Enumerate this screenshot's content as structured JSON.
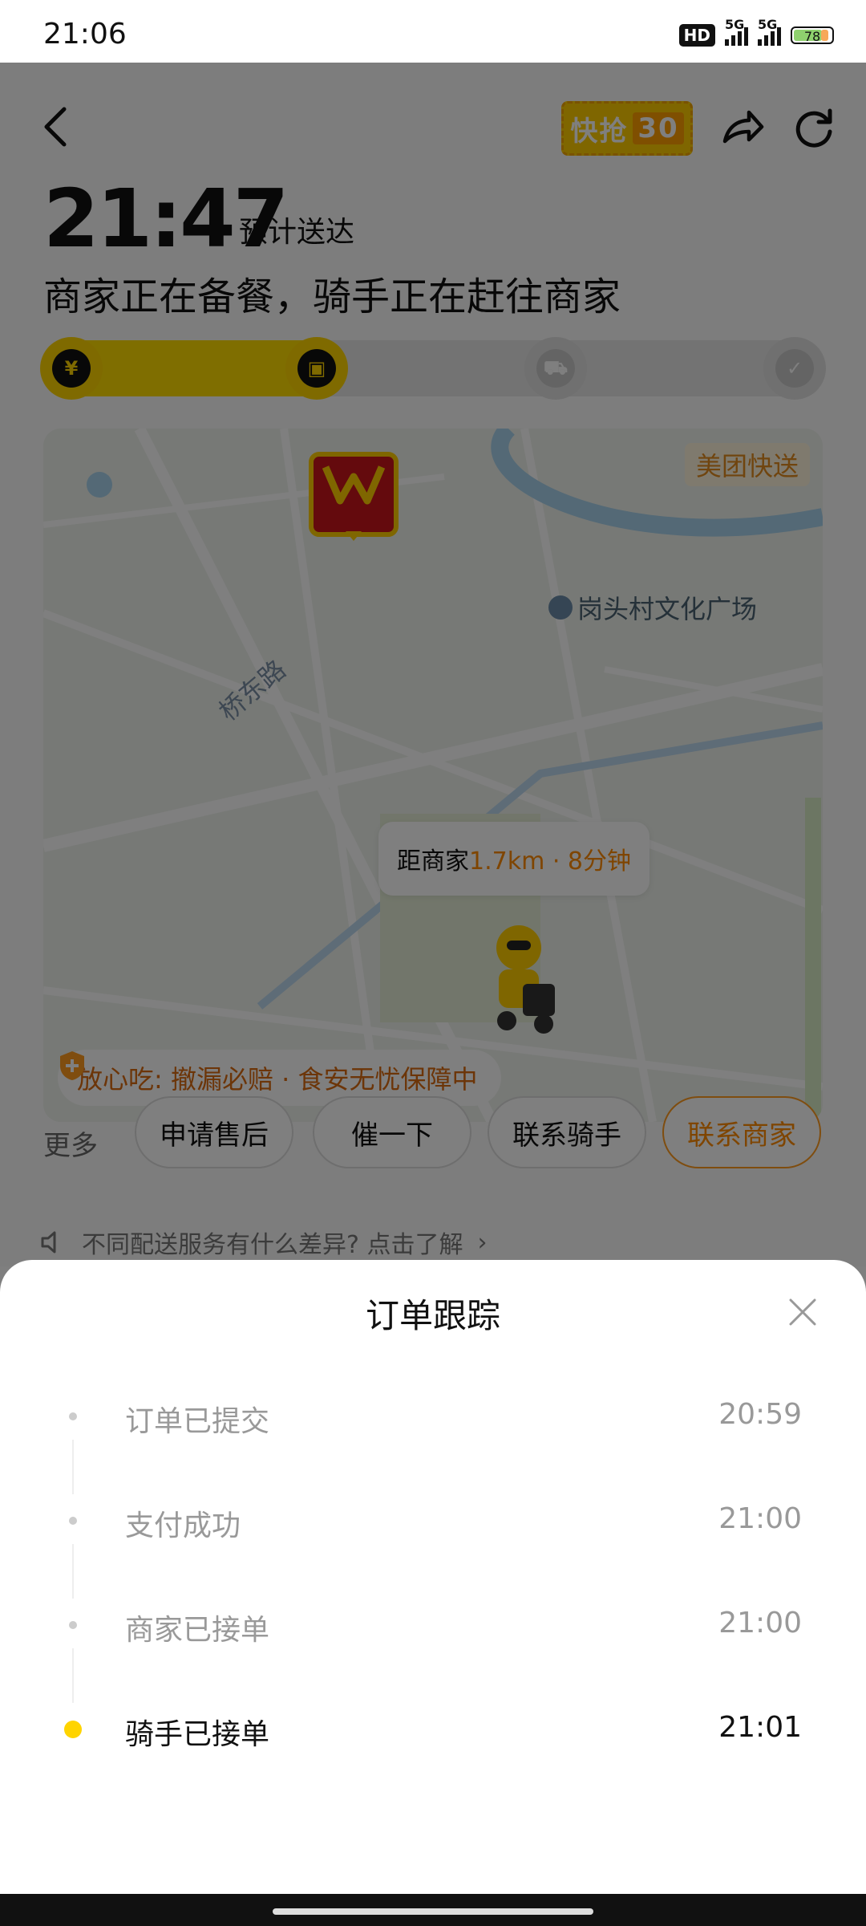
{
  "status_bar": {
    "time": "21:06",
    "hd": "HD",
    "network1": "5G",
    "network2": "5G",
    "battery": "78"
  },
  "header": {
    "brand_badge": "快抢",
    "brand_badge_num": "30"
  },
  "eta": {
    "time": "21:47",
    "label": "预计送达"
  },
  "status_message": "商家正在备餐，骑手正在赶往商家",
  "progress": {
    "fraction": 0.35,
    "steps": [
      {
        "icon": "payment-icon",
        "glyph": "¥"
      },
      {
        "icon": "merchant-icon",
        "glyph": "▣"
      },
      {
        "icon": "rider-icon",
        "glyph": "⛟"
      },
      {
        "icon": "delivered-icon",
        "glyph": "✓"
      }
    ]
  },
  "map": {
    "provider": "美团快送",
    "poi": "岗头村文化广场",
    "road": "桥东路",
    "distance_prefix": "距商家",
    "distance_value": "1.7km · 8分钟",
    "guarantee": "放心吃: 撤漏必赔 · 食安无忧保障中",
    "shop_name": "华莱士"
  },
  "actions": {
    "more": "更多",
    "buttons": [
      "申请售后",
      "催一下",
      "联系骑手",
      "联系商家"
    ]
  },
  "notice": "不同配送服务有什么差异? 点击了解",
  "sheet": {
    "title": "订单跟踪",
    "timeline": [
      {
        "label": "订单已提交",
        "time": "20:59",
        "active": false
      },
      {
        "label": "支付成功",
        "time": "21:00",
        "active": false
      },
      {
        "label": "商家已接单",
        "time": "21:00",
        "active": false
      },
      {
        "label": "骑手已接单",
        "time": "21:01",
        "active": true
      }
    ]
  },
  "colors": {
    "accent": "#ffd400",
    "orange": "#ff8a00",
    "overlay": "#00000080"
  }
}
